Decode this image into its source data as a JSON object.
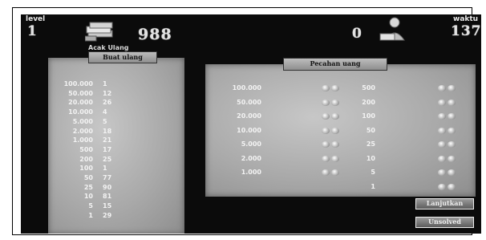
{
  "hud": {
    "level_label": "level",
    "level_value": "1",
    "score": "988",
    "right_counter": "0",
    "time_label": "waktu",
    "time_value": "137"
  },
  "left_panel": {
    "subtitle": "Acak Ulang",
    "tab_label": "Buat ulang",
    "rows": [
      {
        "amount": "100.000",
        "count": "1"
      },
      {
        "amount": "50.000",
        "count": "12"
      },
      {
        "amount": "20.000",
        "count": "26"
      },
      {
        "amount": "10.000",
        "count": "4"
      },
      {
        "amount": "5.000",
        "count": "5"
      },
      {
        "amount": "2.000",
        "count": "18"
      },
      {
        "amount": "1.000",
        "count": "21"
      },
      {
        "amount": "500",
        "count": "17"
      },
      {
        "amount": "200",
        "count": "25"
      },
      {
        "amount": "100",
        "count": "1"
      },
      {
        "amount": "50",
        "count": "77"
      },
      {
        "amount": "25",
        "count": "90"
      },
      {
        "amount": "10",
        "count": "81"
      },
      {
        "amount": "5",
        "count": "15"
      },
      {
        "amount": "1",
        "count": "29"
      }
    ]
  },
  "right_panel": {
    "tab_label": "Pecahan uang",
    "col1": [
      "100.000",
      "50.000",
      "20.000",
      "10.000",
      "5.000",
      "2.000",
      "1.000"
    ],
    "col2": [
      "500",
      "200",
      "100",
      "50",
      "25",
      "10",
      "5",
      "1"
    ]
  },
  "buttons": {
    "continue": "Lanjutkan",
    "unsolved": "Unsolved"
  }
}
